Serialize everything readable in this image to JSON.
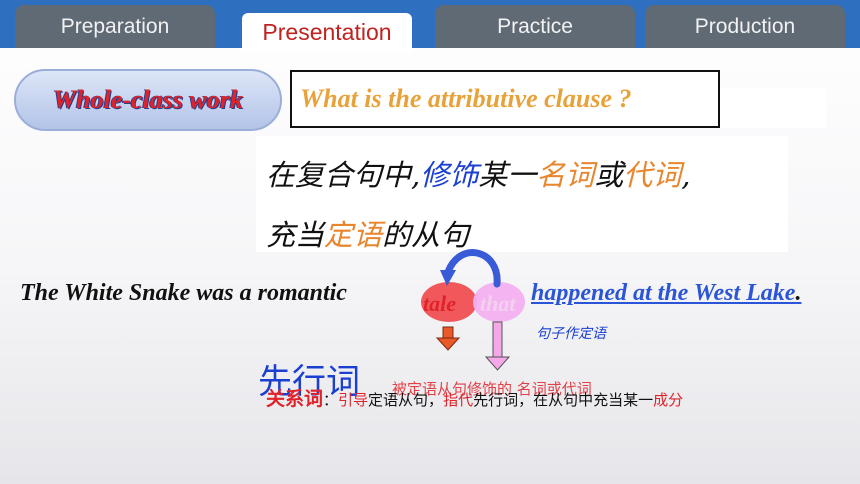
{
  "tabs": [
    {
      "label": "Preparation",
      "active": false
    },
    {
      "label": "Presentation",
      "active": true
    },
    {
      "label": "Practice",
      "active": false
    },
    {
      "label": "Production",
      "active": false
    }
  ],
  "section_label": "Whole-class work",
  "question": "What is the attributive clause ?",
  "definition": {
    "l1_a": "在复合句中,",
    "l1_b": "修饰",
    "l1_c": "某一",
    "l1_d": "名词",
    "l1_e": "或",
    "l1_f": "代词",
    "l1_g": ",",
    "l2_a": "充当",
    "l2_b": "定语",
    "l2_c": "的从句"
  },
  "example": {
    "lead": "The White Snake was a romantic",
    "antecedent": "tale",
    "relative": "that",
    "clause": "happened at the West Lake",
    "end": ".",
    "clause_note": "句子作定语"
  },
  "terms": {
    "antecedent_term": "先行词",
    "overlap_text": "被定语从句修饰的 名词或代词",
    "relative_term": "关系词",
    "colon": "：",
    "fn1": "引导",
    "fn2": "定语从句，",
    "fn3": "指代",
    "fn4": "先行词，在从句中充当某一",
    "fn5": "成分"
  },
  "colors": {
    "top_bar": "#2e6fc0",
    "tab_inactive": "#5f6a75",
    "tab_active_text": "#c0221f",
    "accent_blue": "#1a3fd1",
    "accent_orange": "#e8862e",
    "accent_red": "#e0232a"
  }
}
